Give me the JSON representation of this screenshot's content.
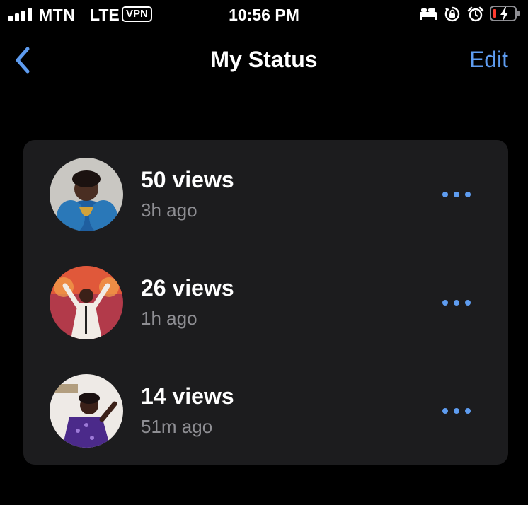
{
  "status_bar": {
    "carrier": "MTN",
    "network": "LTE",
    "vpn": "VPN",
    "time": "10:56 PM",
    "icons": [
      "signal-icon",
      "bed-icon",
      "orientation-lock-icon",
      "alarm-icon",
      "battery-charging-icon"
    ],
    "battery_color": "#ff3b30"
  },
  "nav": {
    "back_icon": "chevron-left-icon",
    "title": "My Status",
    "edit_label": "Edit",
    "accent": "#5e9cf0"
  },
  "statuses": [
    {
      "views": "50 views",
      "ago": "3h ago"
    },
    {
      "views": "26 views",
      "ago": "1h ago"
    },
    {
      "views": "14 views",
      "ago": "51m ago"
    }
  ],
  "colors": {
    "background": "#000000",
    "card": "#1c1c1e",
    "secondary_text": "#8e8e93",
    "divider": "#3a3a3c"
  }
}
